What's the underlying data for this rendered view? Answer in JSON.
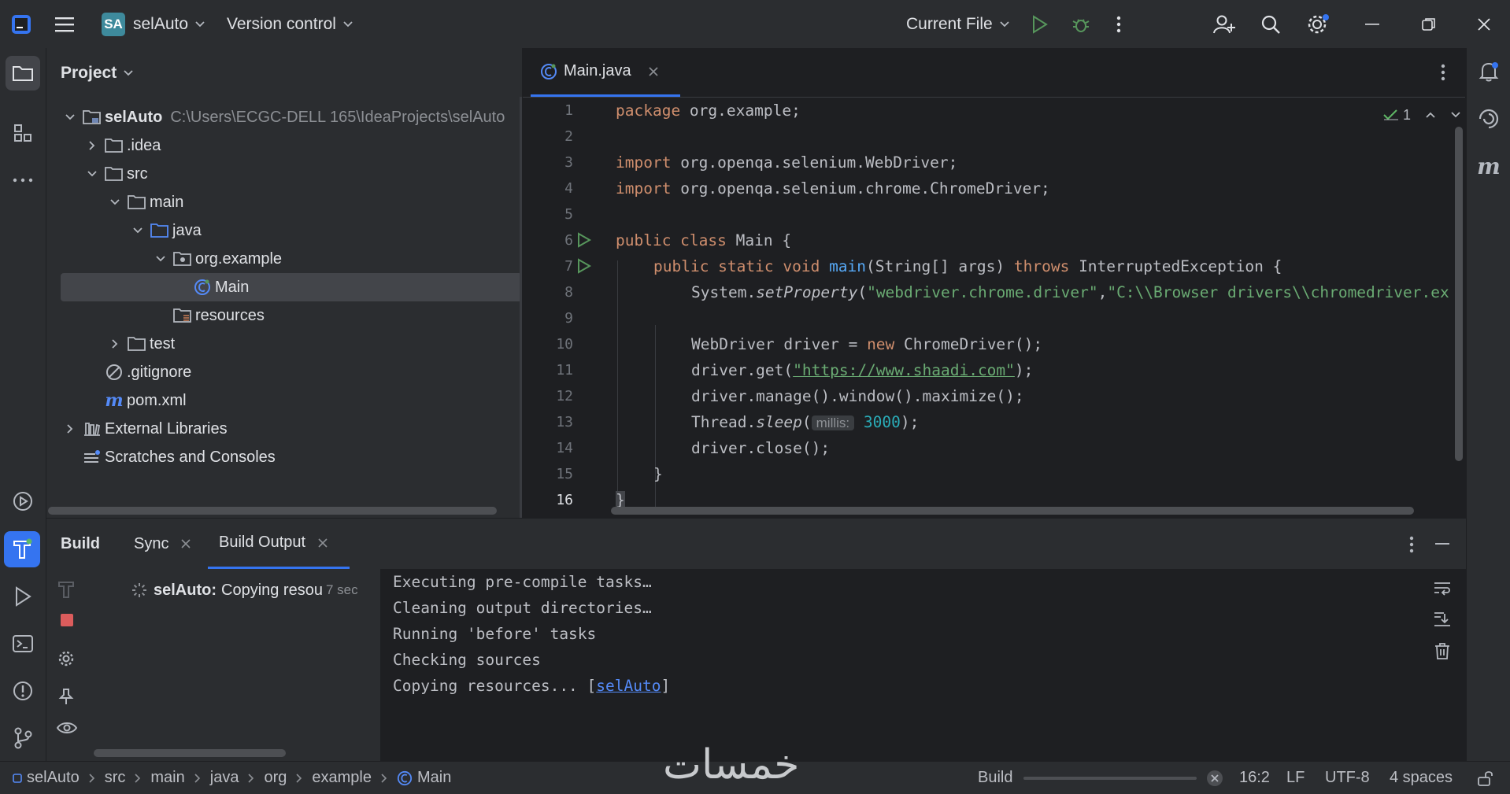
{
  "titlebar": {
    "project_badge": "SA",
    "project_name": "selAuto",
    "vcs": "Version control",
    "run_config": "Current File"
  },
  "project_panel": {
    "title": "Project",
    "tree": [
      {
        "label": "selAuto",
        "path": "C:\\Users\\ECGC-DELL 165\\IdeaProjects\\selAuto"
      },
      {
        "label": ".idea"
      },
      {
        "label": "src"
      },
      {
        "label": "main"
      },
      {
        "label": "java"
      },
      {
        "label": "org.example"
      },
      {
        "label": "Main"
      },
      {
        "label": "resources"
      },
      {
        "label": "test"
      },
      {
        "label": ".gitignore"
      },
      {
        "label": "pom.xml"
      },
      {
        "label": "External Libraries"
      },
      {
        "label": "Scratches and Consoles"
      }
    ]
  },
  "editor": {
    "tab": "Main.java",
    "inspection_count": "1",
    "line_numbers": [
      "1",
      "2",
      "3",
      "4",
      "5",
      "6",
      "7",
      "8",
      "9",
      "10",
      "11",
      "12",
      "13",
      "14",
      "15",
      "16"
    ],
    "code": {
      "l1_kw": "package",
      "l1_rest": " org.example;",
      "l3_kw": "import",
      "l3_rest": " org.openqa.selenium.WebDriver;",
      "l4_kw": "import",
      "l4_rest": " org.openqa.selenium.chrome.ChromeDriver;",
      "l6_kw": "public class",
      "l6_rest": " Main {",
      "l7_kw1": "public static void",
      "l7_fn": " main",
      "l7_mid": "(String[] args) ",
      "l7_kw2": "throws",
      "l7_rest": " InterruptedException {",
      "l8_a": "System.",
      "l8_fn": "setProperty",
      "l8_b": "(",
      "l8_s1": "\"webdriver.chrome.driver\"",
      "l8_c": ",",
      "l8_s2": "\"C:\\\\Browser drivers\\\\chromedriver.ex",
      "l10_a": "WebDriver driver = ",
      "l10_kw": "new",
      "l10_b": " ChromeDriver();",
      "l11_a": "driver.get(",
      "l11_s": "\"https://www.shaadi.com\"",
      "l11_b": ");",
      "l12": "driver.manage().window().maximize();",
      "l13_a": "Thread.",
      "l13_fn": "sleep",
      "l13_b": "(",
      "l13_hint": "millis:",
      "l13_num": "3000",
      "l13_c": ");",
      "l14": "driver.close();",
      "l15": "}",
      "l16": "}"
    }
  },
  "build": {
    "tab_build": "Build",
    "tab_sync": "Sync",
    "tab_output": "Build Output",
    "task_project": "selAuto:",
    "task_text": "Copying resou",
    "task_time": "7 sec",
    "console": [
      "Executing pre-compile tasks…",
      "Cleaning output directories…",
      "Running 'before' tasks",
      "Checking sources"
    ],
    "console_last_prefix": "Copying resources... [",
    "console_last_link": "selAuto",
    "console_last_suffix": "]"
  },
  "statusbar": {
    "breadcrumbs": [
      "selAuto",
      "src",
      "main",
      "java",
      "org",
      "example",
      "Main"
    ],
    "progress_label": "Build",
    "position": "16:2",
    "line_sep": "LF",
    "encoding": "UTF-8",
    "indent": "4 spaces"
  },
  "watermark": "خمسات",
  "colors": {
    "accent": "#3574f0",
    "keyword": "#cf8e6d",
    "string": "#6aab73",
    "function": "#56a8f5",
    "number": "#2aacb8"
  }
}
